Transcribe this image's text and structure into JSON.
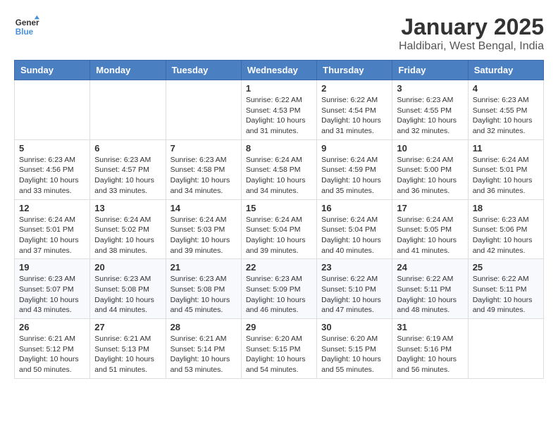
{
  "header": {
    "logo_line1": "General",
    "logo_line2": "Blue",
    "title": "January 2025",
    "subtitle": "Haldibari, West Bengal, India"
  },
  "days_of_week": [
    "Sunday",
    "Monday",
    "Tuesday",
    "Wednesday",
    "Thursday",
    "Friday",
    "Saturday"
  ],
  "weeks": [
    [
      {
        "day": "",
        "info": ""
      },
      {
        "day": "",
        "info": ""
      },
      {
        "day": "",
        "info": ""
      },
      {
        "day": "1",
        "info": "Sunrise: 6:22 AM\nSunset: 4:53 PM\nDaylight: 10 hours\nand 31 minutes."
      },
      {
        "day": "2",
        "info": "Sunrise: 6:22 AM\nSunset: 4:54 PM\nDaylight: 10 hours\nand 31 minutes."
      },
      {
        "day": "3",
        "info": "Sunrise: 6:23 AM\nSunset: 4:55 PM\nDaylight: 10 hours\nand 32 minutes."
      },
      {
        "day": "4",
        "info": "Sunrise: 6:23 AM\nSunset: 4:55 PM\nDaylight: 10 hours\nand 32 minutes."
      }
    ],
    [
      {
        "day": "5",
        "info": "Sunrise: 6:23 AM\nSunset: 4:56 PM\nDaylight: 10 hours\nand 33 minutes."
      },
      {
        "day": "6",
        "info": "Sunrise: 6:23 AM\nSunset: 4:57 PM\nDaylight: 10 hours\nand 33 minutes."
      },
      {
        "day": "7",
        "info": "Sunrise: 6:23 AM\nSunset: 4:58 PM\nDaylight: 10 hours\nand 34 minutes."
      },
      {
        "day": "8",
        "info": "Sunrise: 6:24 AM\nSunset: 4:58 PM\nDaylight: 10 hours\nand 34 minutes."
      },
      {
        "day": "9",
        "info": "Sunrise: 6:24 AM\nSunset: 4:59 PM\nDaylight: 10 hours\nand 35 minutes."
      },
      {
        "day": "10",
        "info": "Sunrise: 6:24 AM\nSunset: 5:00 PM\nDaylight: 10 hours\nand 36 minutes."
      },
      {
        "day": "11",
        "info": "Sunrise: 6:24 AM\nSunset: 5:01 PM\nDaylight: 10 hours\nand 36 minutes."
      }
    ],
    [
      {
        "day": "12",
        "info": "Sunrise: 6:24 AM\nSunset: 5:01 PM\nDaylight: 10 hours\nand 37 minutes."
      },
      {
        "day": "13",
        "info": "Sunrise: 6:24 AM\nSunset: 5:02 PM\nDaylight: 10 hours\nand 38 minutes."
      },
      {
        "day": "14",
        "info": "Sunrise: 6:24 AM\nSunset: 5:03 PM\nDaylight: 10 hours\nand 39 minutes."
      },
      {
        "day": "15",
        "info": "Sunrise: 6:24 AM\nSunset: 5:04 PM\nDaylight: 10 hours\nand 39 minutes."
      },
      {
        "day": "16",
        "info": "Sunrise: 6:24 AM\nSunset: 5:04 PM\nDaylight: 10 hours\nand 40 minutes."
      },
      {
        "day": "17",
        "info": "Sunrise: 6:24 AM\nSunset: 5:05 PM\nDaylight: 10 hours\nand 41 minutes."
      },
      {
        "day": "18",
        "info": "Sunrise: 6:23 AM\nSunset: 5:06 PM\nDaylight: 10 hours\nand 42 minutes."
      }
    ],
    [
      {
        "day": "19",
        "info": "Sunrise: 6:23 AM\nSunset: 5:07 PM\nDaylight: 10 hours\nand 43 minutes."
      },
      {
        "day": "20",
        "info": "Sunrise: 6:23 AM\nSunset: 5:08 PM\nDaylight: 10 hours\nand 44 minutes."
      },
      {
        "day": "21",
        "info": "Sunrise: 6:23 AM\nSunset: 5:08 PM\nDaylight: 10 hours\nand 45 minutes."
      },
      {
        "day": "22",
        "info": "Sunrise: 6:23 AM\nSunset: 5:09 PM\nDaylight: 10 hours\nand 46 minutes."
      },
      {
        "day": "23",
        "info": "Sunrise: 6:22 AM\nSunset: 5:10 PM\nDaylight: 10 hours\nand 47 minutes."
      },
      {
        "day": "24",
        "info": "Sunrise: 6:22 AM\nSunset: 5:11 PM\nDaylight: 10 hours\nand 48 minutes."
      },
      {
        "day": "25",
        "info": "Sunrise: 6:22 AM\nSunset: 5:11 PM\nDaylight: 10 hours\nand 49 minutes."
      }
    ],
    [
      {
        "day": "26",
        "info": "Sunrise: 6:21 AM\nSunset: 5:12 PM\nDaylight: 10 hours\nand 50 minutes."
      },
      {
        "day": "27",
        "info": "Sunrise: 6:21 AM\nSunset: 5:13 PM\nDaylight: 10 hours\nand 51 minutes."
      },
      {
        "day": "28",
        "info": "Sunrise: 6:21 AM\nSunset: 5:14 PM\nDaylight: 10 hours\nand 53 minutes."
      },
      {
        "day": "29",
        "info": "Sunrise: 6:20 AM\nSunset: 5:15 PM\nDaylight: 10 hours\nand 54 minutes."
      },
      {
        "day": "30",
        "info": "Sunrise: 6:20 AM\nSunset: 5:15 PM\nDaylight: 10 hours\nand 55 minutes."
      },
      {
        "day": "31",
        "info": "Sunrise: 6:19 AM\nSunset: 5:16 PM\nDaylight: 10 hours\nand 56 minutes."
      },
      {
        "day": "",
        "info": ""
      }
    ]
  ]
}
